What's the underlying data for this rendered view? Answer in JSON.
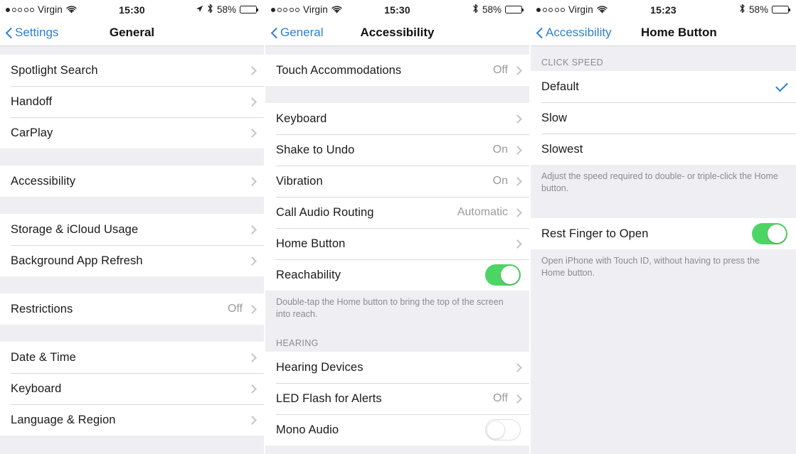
{
  "panels": [
    {
      "status": {
        "carrier": "Virgin",
        "time": "15:30",
        "battery_pct": "58%",
        "signal_filled": 1,
        "signal_total": 5,
        "has_location": true,
        "has_bluetooth": true,
        "has_wifi": true
      },
      "nav": {
        "back_label": "Settings",
        "title": "General"
      },
      "sections": [
        {
          "rows": [
            {
              "label": "Spotlight Search",
              "accessory": "chevron"
            },
            {
              "label": "Handoff",
              "accessory": "chevron"
            },
            {
              "label": "CarPlay",
              "accessory": "chevron"
            }
          ]
        },
        {
          "rows": [
            {
              "label": "Accessibility",
              "accessory": "chevron"
            }
          ]
        },
        {
          "rows": [
            {
              "label": "Storage & iCloud Usage",
              "accessory": "chevron"
            },
            {
              "label": "Background App Refresh",
              "accessory": "chevron"
            }
          ]
        },
        {
          "rows": [
            {
              "label": "Restrictions",
              "value": "Off",
              "accessory": "chevron"
            }
          ]
        },
        {
          "rows": [
            {
              "label": "Date & Time",
              "accessory": "chevron"
            },
            {
              "label": "Keyboard",
              "accessory": "chevron"
            },
            {
              "label": "Language & Region",
              "accessory": "chevron"
            }
          ]
        }
      ]
    },
    {
      "status": {
        "carrier": "Virgin",
        "time": "15:30",
        "battery_pct": "58%",
        "signal_filled": 1,
        "signal_total": 5,
        "has_location": false,
        "has_bluetooth": true,
        "has_wifi": true
      },
      "nav": {
        "back_label": "General",
        "title": "Accessibility"
      },
      "sections": [
        {
          "rows": [
            {
              "label": "Touch Accommodations",
              "value": "Off",
              "accessory": "chevron"
            }
          ]
        },
        {
          "rows": [
            {
              "label": "Keyboard",
              "accessory": "chevron"
            },
            {
              "label": "Shake to Undo",
              "value": "On",
              "accessory": "chevron"
            },
            {
              "label": "Vibration",
              "value": "On",
              "accessory": "chevron"
            },
            {
              "label": "Call Audio Routing",
              "value": "Automatic",
              "accessory": "chevron"
            },
            {
              "label": "Home Button",
              "accessory": "chevron"
            },
            {
              "label": "Reachability",
              "accessory": "toggle-on"
            }
          ],
          "footnote": "Double-tap the Home button to bring the top of the screen into reach."
        },
        {
          "header": "HEARING",
          "rows": [
            {
              "label": "Hearing Devices",
              "accessory": "chevron"
            },
            {
              "label": "LED Flash for Alerts",
              "value": "Off",
              "accessory": "chevron"
            },
            {
              "label": "Mono Audio",
              "accessory": "toggle-off"
            }
          ]
        }
      ]
    },
    {
      "status": {
        "carrier": "Virgin",
        "time": "15:23",
        "battery_pct": "58%",
        "signal_filled": 1,
        "signal_total": 5,
        "has_location": false,
        "has_bluetooth": true,
        "has_wifi": true
      },
      "nav": {
        "back_label": "Accessibility",
        "title": "Home Button"
      },
      "sections": [
        {
          "header": "CLICK SPEED",
          "rows": [
            {
              "label": "Default",
              "accessory": "check"
            },
            {
              "label": "Slow",
              "accessory": "none"
            },
            {
              "label": "Slowest",
              "accessory": "none"
            }
          ],
          "footnote": "Adjust the speed required to double- or triple-click the Home button."
        },
        {
          "rows": [
            {
              "label": "Rest Finger to Open",
              "accessory": "toggle-on"
            }
          ],
          "footnote": "Open iPhone with Touch ID, without having to press the Home button."
        }
      ]
    }
  ],
  "colors": {
    "accent_blue": "#2f7fd0",
    "toggle_green": "#4cd564",
    "background_gray": "#efeef2",
    "value_gray": "#9a9a9f"
  }
}
